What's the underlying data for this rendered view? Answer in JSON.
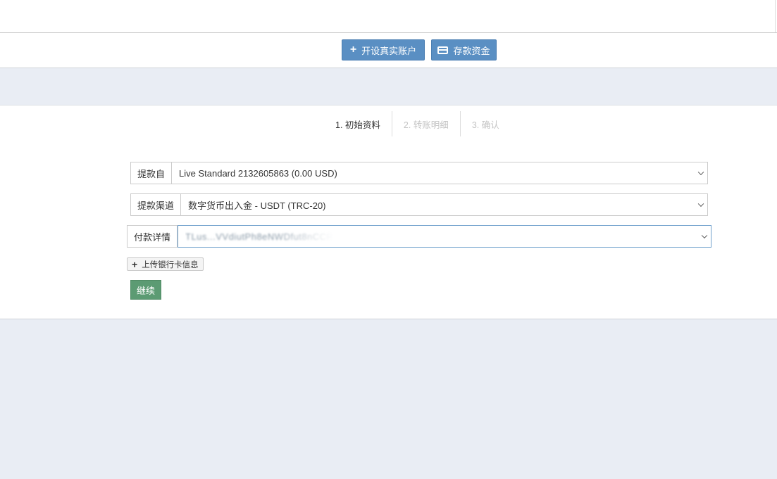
{
  "header": {
    "open_account_label": "开设真实账户",
    "deposit_label": "存款资金"
  },
  "steps": [
    {
      "label": "1. 初始资料",
      "active": true
    },
    {
      "label": "2. 转账明细",
      "active": false
    },
    {
      "label": "3. 确认",
      "active": false
    }
  ],
  "form": {
    "from_label": "提款自",
    "from_value": "Live Standard 2132605863 (0.00 USD)",
    "channel_label": "提款渠道",
    "channel_value": "数字货币出入金 - USDT (TRC-20)",
    "payment_label": "付款详情",
    "payment_value": "TLus...VVdiutPh8eNWDfut8nCCR",
    "upload_label": "上传银行卡信息",
    "continue_label": "继续"
  },
  "colors": {
    "primary_button": "#5a8fc3",
    "success_button": "#5c9b73",
    "page_background": "#e9edf4"
  },
  "icons": {
    "open_account": "plus-icon",
    "deposit": "credit-card-icon",
    "upload": "plus-icon"
  }
}
